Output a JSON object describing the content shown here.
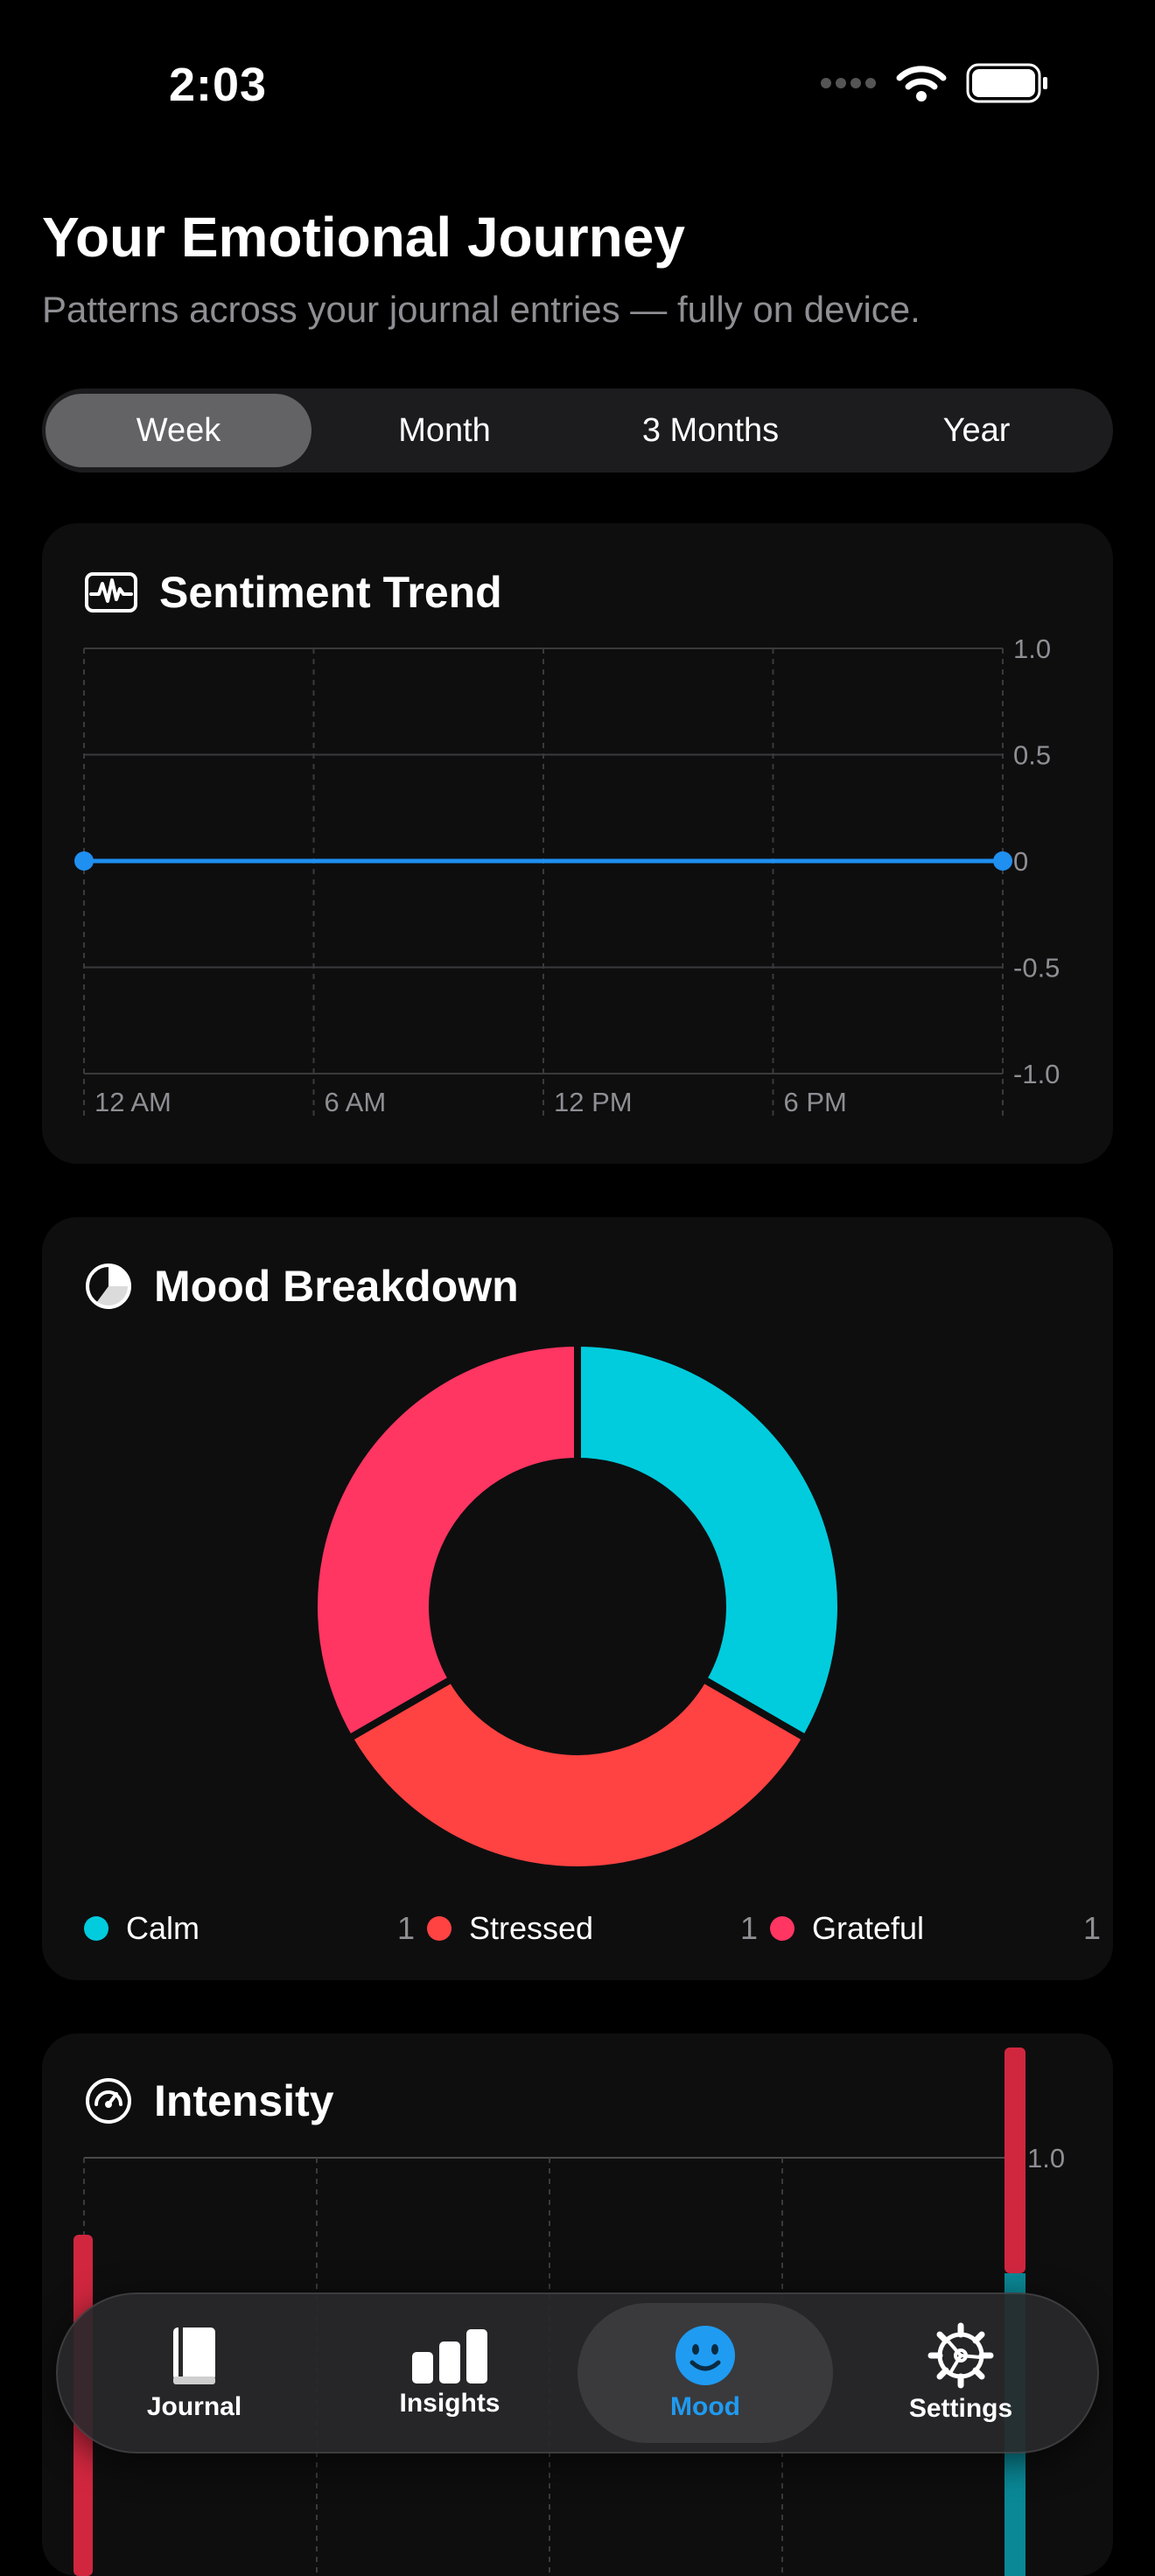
{
  "status": {
    "time": "2:03"
  },
  "header": {
    "title": "Your Emotional Journey",
    "subtitle": "Patterns across your journal entries — fully on device."
  },
  "range_tabs": [
    {
      "label": "Week",
      "selected": true
    },
    {
      "label": "Month",
      "selected": false
    },
    {
      "label": "3 Months",
      "selected": false
    },
    {
      "label": "Year",
      "selected": false
    }
  ],
  "sentiment_card": {
    "title": "Sentiment Trend",
    "icon": "waveform-icon"
  },
  "mood_card": {
    "title": "Mood Breakdown",
    "icon": "pie-chart-icon"
  },
  "intensity_card": {
    "title": "Intensity",
    "icon": "gauge-icon"
  },
  "tabbar": [
    {
      "label": "Journal",
      "icon": "book-icon",
      "active": false
    },
    {
      "label": "Insights",
      "icon": "bar-chart-icon",
      "active": false
    },
    {
      "label": "Mood",
      "icon": "smiley-face-icon",
      "active": true
    },
    {
      "label": "Settings",
      "icon": "gear-icon",
      "active": false
    }
  ],
  "chart_data": [
    {
      "type": "line",
      "title": "Sentiment Trend",
      "x_ticks": [
        "12 AM",
        "6 AM",
        "12 PM",
        "6 PM"
      ],
      "y_ticks": [
        "1.0",
        "0.5",
        "0",
        "-0.5",
        "-1.0"
      ],
      "ylim": [
        -1.0,
        1.0
      ],
      "series": [
        {
          "points": [
            {
              "x": "12 AM",
              "y": 0
            },
            {
              "x": "12 AM next day",
              "y": 0
            }
          ]
        }
      ],
      "grid": true,
      "color": "#1f8ff0"
    },
    {
      "type": "pie",
      "title": "Mood Breakdown",
      "slices": [
        {
          "label": "Calm",
          "value": 1,
          "color": "#00ccdd"
        },
        {
          "label": "Stressed",
          "value": 1,
          "color": "#ff4242"
        },
        {
          "label": "Grateful",
          "value": 1,
          "color": "#ff3562"
        }
      ]
    },
    {
      "type": "bar",
      "title": "Intensity",
      "y_ticks": [
        "1.0"
      ],
      "grid": true
    }
  ]
}
